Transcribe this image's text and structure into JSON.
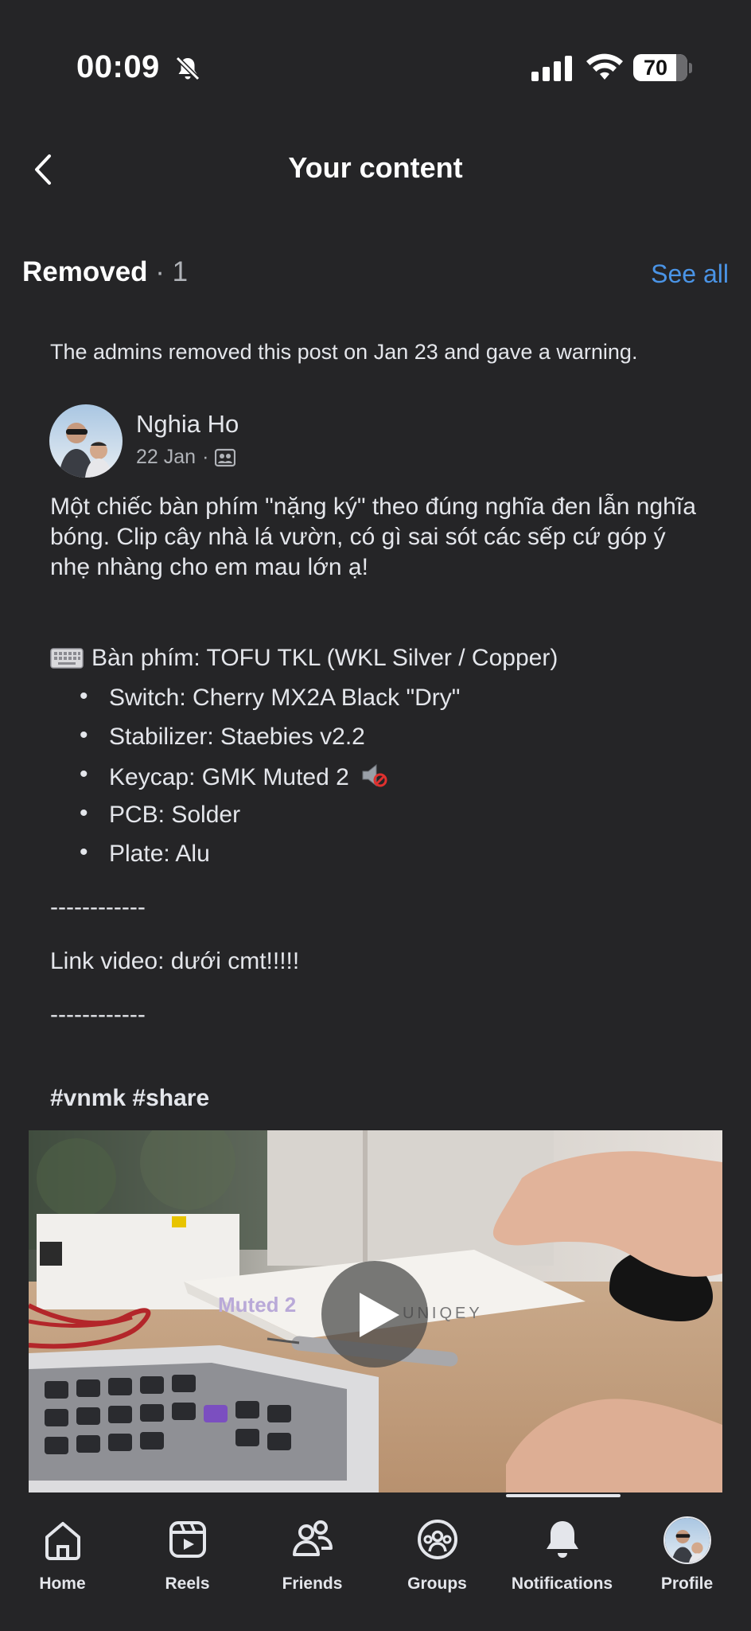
{
  "status_bar": {
    "time": "00:09",
    "battery_percent": "70"
  },
  "header": {
    "title": "Your content"
  },
  "section": {
    "title": "Removed",
    "separator": " · ",
    "count": "1",
    "see_all": "See all"
  },
  "post": {
    "notice": "The admins removed this post on Jan 23 and gave a warning.",
    "author": "Nghia Ho",
    "date": "22 Jan",
    "dot": "·",
    "body": "Một chiếc bàn phím \"nặng ký\" theo đúng nghĩa đen lẫn nghĩa bóng. Clip cây nhà lá vườn, có gì sai sót các sếp cứ góp ý nhẹ nhàng cho em mau lớn ạ!",
    "keyboard_line": "Bàn phím: TOFU TKL (WKL Silver / Copper)",
    "specs": [
      "Switch: Cherry MX2A Black \"Dry\"",
      "Stabilizer: Staebies v2.2",
      "Keycap: GMK Muted 2",
      "PCB: Solder",
      "Plate: Alu"
    ],
    "bullet": "•",
    "divider": "------------",
    "link_line": "Link video: dưới cmt!!!!!",
    "hashtags": "#vnmk #share",
    "video_box_text": [
      "Muted 2",
      "UNIQEY"
    ]
  },
  "bottom_nav": {
    "items": [
      {
        "label": "Home",
        "icon": "home-icon"
      },
      {
        "label": "Reels",
        "icon": "reels-icon"
      },
      {
        "label": "Friends",
        "icon": "friends-icon"
      },
      {
        "label": "Groups",
        "icon": "groups-icon"
      },
      {
        "label": "Notifications",
        "icon": "bell-icon"
      },
      {
        "label": "Profile",
        "icon": "profile-avatar"
      }
    ],
    "active": "Notifications"
  },
  "colors": {
    "background": "#252527",
    "link": "#4a94e6",
    "text": "#e4e6eb",
    "muted": "#b0b3b8"
  }
}
